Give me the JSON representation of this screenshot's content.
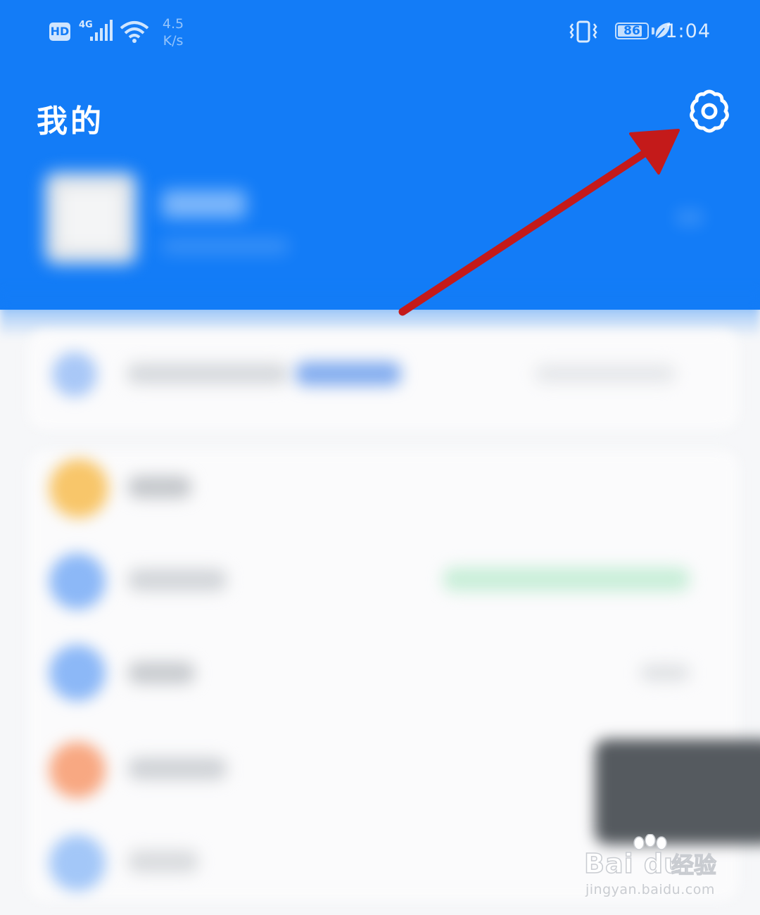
{
  "status_bar": {
    "hd": "HD",
    "network": "4G",
    "speed_value": "4.5",
    "speed_unit": "K/s",
    "battery": "86",
    "battery_level": 0.86,
    "time": "1:04"
  },
  "header": {
    "title": "我的",
    "background_color": "#137cf7"
  },
  "icons": {
    "settings": "gear-icon",
    "annotation": "red-arrow-pointer"
  },
  "accent_colors": {
    "annotation_arrow": "#c41a1a",
    "list_icon_blue": "#8cb8f7",
    "list_icon_yellow": "#f8c66a",
    "list_icon_orange": "#f8a882",
    "badge_green": "#c8eed8"
  },
  "watermark": {
    "brand": "Bai du",
    "product": "经验",
    "url": "jingyan.baidu.com"
  }
}
